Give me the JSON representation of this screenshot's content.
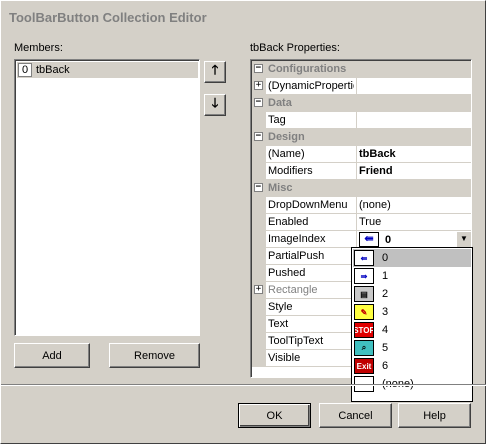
{
  "window": {
    "title": "ToolBarButton Collection Editor"
  },
  "members": {
    "label": "Members:",
    "items": [
      {
        "index": "0",
        "name": "tbBack"
      }
    ],
    "add_label": "Add",
    "remove_label": "Remove"
  },
  "properties": {
    "label": "tbBack Properties:",
    "rows": [
      {
        "type": "cat",
        "name": "Configurations"
      },
      {
        "type": "prop",
        "name": "(DynamicPropertie",
        "value": "",
        "expandable": true
      },
      {
        "type": "cat",
        "name": "Data"
      },
      {
        "type": "prop",
        "name": "Tag",
        "value": ""
      },
      {
        "type": "cat",
        "name": "Design"
      },
      {
        "type": "prop",
        "name": "(Name)",
        "value": "tbBack",
        "bold": true
      },
      {
        "type": "prop",
        "name": "Modifiers",
        "value": "Friend",
        "bold": true
      },
      {
        "type": "cat",
        "name": "Misc"
      },
      {
        "type": "prop",
        "name": "DropDownMenu",
        "value": "(none)"
      },
      {
        "type": "prop",
        "name": "Enabled",
        "value": "True"
      },
      {
        "type": "prop",
        "name": "ImageIndex",
        "value": "0",
        "bold": true
      },
      {
        "type": "prop",
        "name": "PartialPush",
        "value": ""
      },
      {
        "type": "prop",
        "name": "Pushed",
        "value": ""
      },
      {
        "type": "prop",
        "name": "Rectangle",
        "value": "",
        "expandable": true,
        "gray": true
      },
      {
        "type": "prop",
        "name": "Style",
        "value": ""
      },
      {
        "type": "prop",
        "name": "Text",
        "value": ""
      },
      {
        "type": "prop",
        "name": "ToolTipText",
        "value": ""
      },
      {
        "type": "prop",
        "name": "Visible",
        "value": ""
      }
    ]
  },
  "image_dropdown": {
    "items": [
      {
        "label": "0",
        "icon": "back-arrow-icon"
      },
      {
        "label": "1",
        "icon": "forward-arrow-icon"
      },
      {
        "label": "2",
        "icon": "printer-icon"
      },
      {
        "label": "3",
        "icon": "pencil-icon"
      },
      {
        "label": "4",
        "icon": "stop-sign-icon",
        "text": "STOP"
      },
      {
        "label": "5",
        "icon": "search-icon"
      },
      {
        "label": "6",
        "icon": "exit-icon",
        "text": "Exit"
      },
      {
        "label": "(none)",
        "icon": "empty-icon"
      }
    ],
    "selected": "0"
  },
  "buttons": {
    "ok": "OK",
    "cancel": "Cancel",
    "help": "Help"
  }
}
